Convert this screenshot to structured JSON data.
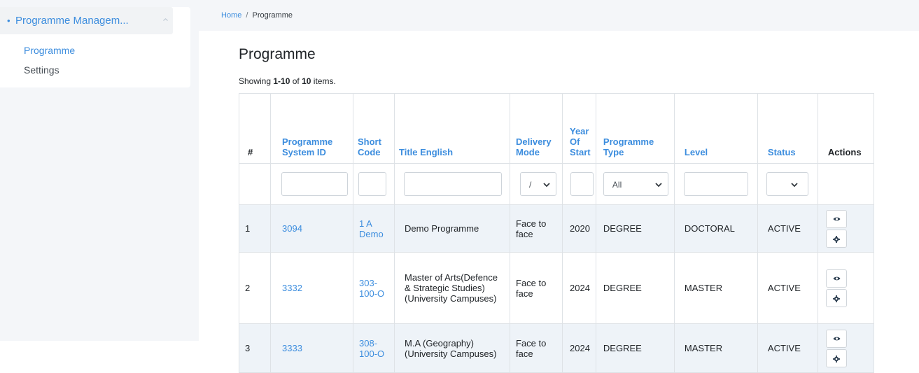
{
  "sidebar": {
    "group_label": "Programme Managem...",
    "items": [
      {
        "label": "Programme"
      },
      {
        "label": "Settings"
      }
    ]
  },
  "breadcrumb": {
    "home": "Home",
    "separator": "/",
    "current": "Programme"
  },
  "page": {
    "title": "Programme",
    "summary_prefix": "Showing ",
    "summary_range": "1-10",
    "summary_of": " of ",
    "summary_total": "10",
    "summary_suffix": " items."
  },
  "table": {
    "headers": {
      "index": "#",
      "system_id": "Programme System ID",
      "short_code": "Short Code",
      "title": "Title English",
      "delivery": "Delivery Mode",
      "year": "Year Of Start",
      "type": "Programme Type",
      "level": "Level",
      "status": "Status",
      "actions": "Actions"
    },
    "filters": {
      "delivery_value": "/",
      "type_value": "All",
      "status_value": ""
    },
    "rows": [
      {
        "index": "1",
        "system_id": "3094",
        "short_code": "1 A Demo",
        "title": "Demo Programme",
        "delivery": "Face to face",
        "year": "2020",
        "type": "DEGREE",
        "level": "DOCTORAL",
        "status": "ACTIVE"
      },
      {
        "index": "2",
        "system_id": "3332",
        "short_code": "303-100-O",
        "title": "Master of Arts(Defence & Strategic Studies) (University Campuses)",
        "delivery": "Face to face",
        "year": "2024",
        "type": "DEGREE",
        "level": "MASTER",
        "status": "ACTIVE"
      },
      {
        "index": "3",
        "system_id": "3333",
        "short_code": "308-100-O",
        "title": "M.A (Geography) (University Campuses)",
        "delivery": "Face to face",
        "year": "2024",
        "type": "DEGREE",
        "level": "MASTER",
        "status": "ACTIVE"
      }
    ]
  },
  "icons": {
    "view": "eye-icon",
    "settings": "gear-icon"
  },
  "colors": {
    "accent": "#3c8dde",
    "row_stripe": "#eef3f8",
    "sidebar_bg": "#f4f6f9"
  }
}
